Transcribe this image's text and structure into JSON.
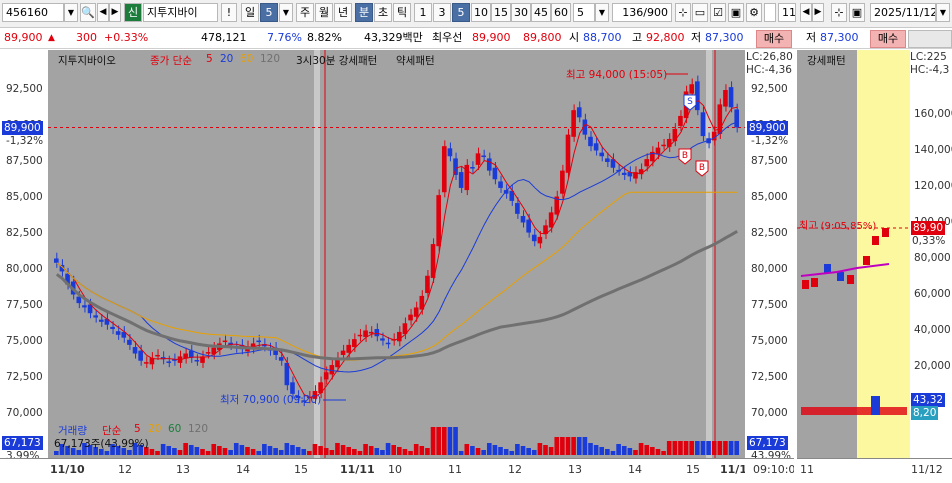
{
  "toolbar": {
    "code": "456160",
    "badge": "신",
    "name": "지투지바이",
    "exclaim": "!",
    "period_day": "일",
    "period_num": "5",
    "tabs": [
      "주",
      "월",
      "년",
      "분",
      "초",
      "틱"
    ],
    "minutes": [
      "1",
      "3",
      "5",
      "10",
      "15",
      "30",
      "45",
      "60"
    ],
    "sel_minute": "5",
    "count": "5",
    "view": "136/900",
    "right_code": "11/",
    "date": "2025/11/12"
  },
  "quote": {
    "price": "89,900",
    "arrow": "▲",
    "change": "300",
    "change_pct": "+0.33%",
    "volume": "478,121",
    "turnover_pct": "7.76%",
    "rate2": "8.82%",
    "amount": "43,329백만",
    "best_label": "최우선",
    "ask": "89,900",
    "bid": "89,800",
    "open_label": "시",
    "open": "88,700",
    "high_label": "고",
    "high": "92,800",
    "low_label": "저",
    "low": "87,300",
    "buy_label": "매수",
    "right_low_label": "저",
    "right_low": "87,300",
    "right_buy_label": "매수"
  },
  "legend": {
    "name": "지투지바이오",
    "ma_label": "종가 단순",
    "ma5": "5",
    "ma20": "20",
    "ma60": "60",
    "ma120": "120",
    "pattern1": "3시30분 강세패턴",
    "pattern2": "약세패턴",
    "right_pattern": "강세패턴"
  },
  "annotations": {
    "high": "최고 94,000 (15:05)",
    "low": "최저 70,900 (09:20)",
    "mini_high": "최고 (9:05,85%)"
  },
  "volume_legend": {
    "label": "거래량",
    "ma_label": "단순",
    "ma5": "5",
    "ma20": "20",
    "ma60": "60",
    "ma120": "120",
    "summary": "67,173주(43,99%)"
  },
  "left_axis": {
    "price": "89,900",
    "pct": "-1,32%",
    "vol": "67,173",
    "vol_pct": "3,99%",
    "ticks": [
      "92,500",
      "90,000",
      "87,500",
      "85,000",
      "82,500",
      "80,000",
      "77,500",
      "75,000",
      "72,500",
      "70,000"
    ]
  },
  "right_axis": {
    "lc": "LC:26,80",
    "hc": "HC:-4,36",
    "price": "89,900",
    "pct": "-1,32%",
    "vol": "67,173",
    "vol_pct": "43,99%",
    "ticks": [
      "92,500",
      "90,000",
      "87,500",
      "85,000",
      "82,500",
      "80,000",
      "77,500",
      "75,000",
      "72,500",
      "70,000"
    ]
  },
  "mini_axis": {
    "lc": "LC:225",
    "hc": "HC:-4,3",
    "price": "89,90",
    "pct": "0,33%",
    "vol1": "43,32",
    "vol2": "8,20",
    "ticks": [
      "160,000",
      "140,000",
      "120,000",
      "100,000",
      "80,000",
      "60,000",
      "40,000",
      "20,000"
    ]
  },
  "x_axis": {
    "labels": [
      "11/10",
      "12",
      "13",
      "14",
      "15",
      "11/11",
      "10",
      "11",
      "12",
      "13",
      "14",
      "15",
      "11/1"
    ],
    "time": "09:10:0",
    "mini": "11",
    "mini_right": "11/12"
  },
  "colors": {
    "up": "#e0000d",
    "down": "#1a3bd8",
    "ma5": "#e0000d",
    "ma20": "#1a3bd8",
    "ma60": "#e8a000",
    "ma120": "#707070"
  }
}
